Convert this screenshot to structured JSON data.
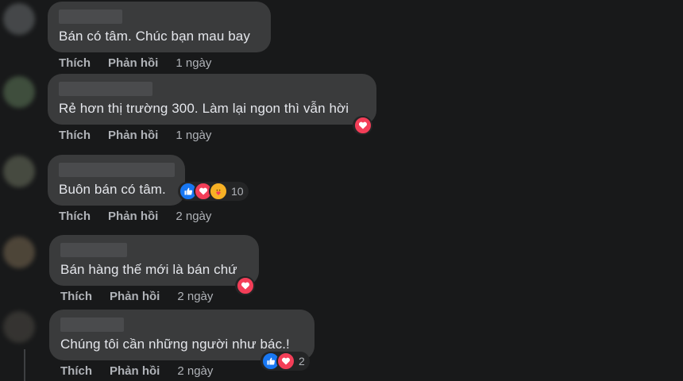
{
  "comments": [
    {
      "text": "Bán có tâm. Chúc bạn mau bay",
      "like": "Thích",
      "reply": "Phản hồi",
      "time": "1 ngày"
    },
    {
      "text": "Rẻ hơn thị trường 300. Làm lại ngon thì vẫn hời",
      "like": "Thích",
      "reply": "Phản hồi",
      "time": "1 ngày"
    },
    {
      "text": "Buôn bán có tâm.",
      "like": "Thích",
      "reply": "Phản hồi",
      "time": "2 ngày",
      "reaction_count": "10"
    },
    {
      "text": "Bán hàng thế mới là bán chứ",
      "like": "Thích",
      "reply": "Phản hồi",
      "time": "2 ngày"
    },
    {
      "text": "Chúng tôi cần những người như bác.!",
      "like": "Thích",
      "reply": "Phản hồi",
      "time": "2 ngày",
      "reaction_count": "2"
    }
  ],
  "icons": {
    "like": "like-reaction-icon",
    "love": "love-reaction-icon",
    "care": "care-reaction-icon"
  },
  "colors": {
    "background": "#18191a",
    "bubble": "#3a3b3c",
    "like_blue": "#1877f2",
    "love_red": "#f33e58",
    "care_yellow": "#f7b125"
  }
}
